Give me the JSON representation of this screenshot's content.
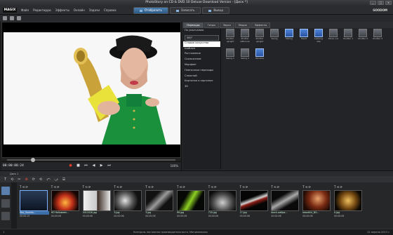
{
  "window": {
    "title": "PhotoStory on CD & DVD 10 Deluxe Download Version - [Диск *]",
    "controls": [
      "_",
      "□",
      "×"
    ]
  },
  "menubar": {
    "logo": "MAGIX",
    "items": [
      "Файл",
      "Редактирую",
      "Эффекты",
      "Онлайн",
      "Задачи",
      "Справка"
    ],
    "modes": [
      {
        "label": "Отобразить",
        "active": true
      },
      {
        "label": "Записать",
        "active": false
      },
      {
        "label": "Вывод",
        "active": false
      }
    ],
    "brand": "GOODOM"
  },
  "player": {
    "timecode": "00:00:08:24",
    "zoom": "100%"
  },
  "effects": {
    "tabs": [
      {
        "label": "Переходы",
        "active": true
      },
      {
        "label": "Титры",
        "active": false
      },
      {
        "label": "Звуки",
        "active": false
      },
      {
        "label": "Медиа",
        "active": false
      },
      {
        "label": "Эффекты",
        "active": false
      }
    ],
    "category_header": "По умолчанию",
    "dropdown_value": "360°",
    "categories": [
      "Старые искусства",
      "Шаблон",
      "Растяжение",
      "Скольжение",
      "Морфинг",
      "Пленочные переходы",
      "Сложный ",
      "Картинка в картинке",
      "3D"
    ],
    "selected_category": 0,
    "items": [
      {
        "label": "Shutter upright",
        "style": "gray"
      },
      {
        "label": "Shutter leftmove",
        "style": "gray"
      },
      {
        "label": "Shutter upright",
        "style": "gray"
      },
      {
        "label": "Swing",
        "style": "gray"
      },
      {
        "label": "Fading",
        "style": "blue"
      },
      {
        "label": "Heart",
        "style": "blue"
      },
      {
        "label": "Leaving site",
        "style": "blue"
      },
      {
        "label": "Move out",
        "style": "gray"
      },
      {
        "label": "Shutter 1",
        "style": "gray"
      },
      {
        "label": "Shutter 2",
        "style": "gray"
      },
      {
        "label": "Shutter 3",
        "style": "gray"
      },
      {
        "label": "Swing 1",
        "style": "gray"
      },
      {
        "label": "Swing 2",
        "style": "gray"
      },
      {
        "label": "Window",
        "style": "blue"
      }
    ]
  },
  "timeline": {
    "ruler": "Диск 1",
    "tools": [
      "T",
      "⟲",
      "✂",
      "⊗",
      "⟳",
      "⟲",
      "⤺",
      "⤻",
      "☰"
    ],
    "clips": [
      {
        "name": "Mac_Sounds...",
        "duration": "00:00:15",
        "style": "dark",
        "selected": true
      },
      {
        "name": "HD Halloween...",
        "duration": "00:00:06",
        "style": "fire",
        "selected": false
      },
      {
        "name": "2012028.jpg",
        "duration": "00:00:06",
        "style": "woman",
        "selected": false
      },
      {
        "name": "3.jpg",
        "duration": "00:00:06",
        "style": "swirl",
        "selected": false
      },
      {
        "name": "3.jpg",
        "duration": "00:00:06",
        "style": "ribbon",
        "selected": false
      },
      {
        "name": "99.jpg",
        "duration": "00:00:06",
        "style": "green",
        "selected": false
      },
      {
        "name": "720.jpg",
        "duration": "00:00:06",
        "style": "mouse",
        "selected": false
      },
      {
        "name": "17.jpg",
        "duration": "00:00:06",
        "style": "blade",
        "selected": false
      },
      {
        "name": "black-wallpa...",
        "duration": "00:00:06",
        "style": "blade2",
        "selected": false
      },
      {
        "name": "beautiful_BO...",
        "duration": "00:00:06",
        "style": "portrait",
        "selected": false
      },
      {
        "name": "0.jpg",
        "duration": "00:00:06",
        "style": "gold",
        "selected": false
      }
    ]
  },
  "status": {
    "left": "1",
    "middle": "Контроль постоянно производительность: Минимальная",
    "right": "22 апреля 2013 г."
  }
}
